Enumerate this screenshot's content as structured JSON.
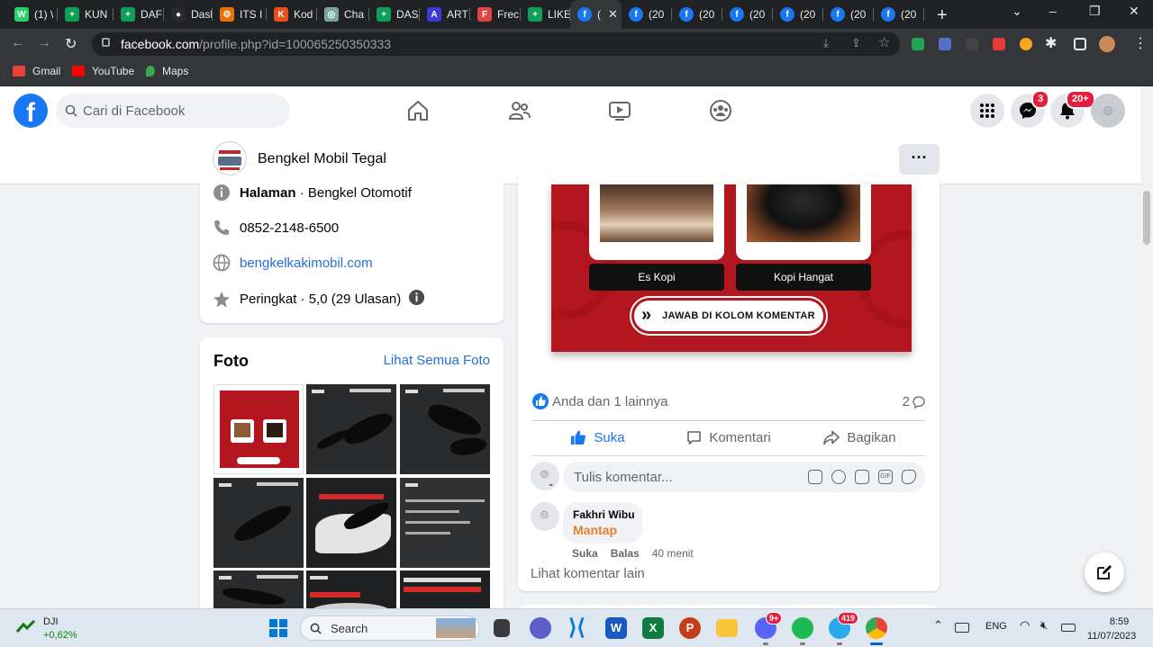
{
  "browser": {
    "tabs": [
      {
        "label": "(1) \\",
        "color": "#25d366",
        "glyph": "W"
      },
      {
        "label": "KUN",
        "color": "#0f9d58",
        "glyph": "+"
      },
      {
        "label": "DAF",
        "color": "#0f9d58",
        "glyph": "+"
      },
      {
        "label": "Dasl",
        "color": "#2a2a2a",
        "glyph": "●"
      },
      {
        "label": "ITS I",
        "color": "#e8710a",
        "glyph": "⚙"
      },
      {
        "label": "Kod",
        "color": "#e8501a",
        "glyph": "K"
      },
      {
        "label": "Cha",
        "color": "#74aa9c",
        "glyph": "◎"
      },
      {
        "label": "DAS",
        "color": "#0f9d58",
        "glyph": "+"
      },
      {
        "label": "ART",
        "color": "#3b3bd6",
        "glyph": "A"
      },
      {
        "label": "Frec",
        "color": "#e04646",
        "glyph": "F"
      },
      {
        "label": "LIKE",
        "color": "#0f9d58",
        "glyph": "+"
      },
      {
        "label": "(",
        "color": "#1877f2",
        "glyph": "f"
      },
      {
        "label": "(20",
        "color": "#1877f2",
        "glyph": "f"
      },
      {
        "label": "(20",
        "color": "#1877f2",
        "glyph": "f"
      },
      {
        "label": "(20",
        "color": "#1877f2",
        "glyph": "f"
      },
      {
        "label": "(20",
        "color": "#1877f2",
        "glyph": "f"
      },
      {
        "label": "(20",
        "color": "#1877f2",
        "glyph": "f"
      },
      {
        "label": "(20",
        "color": "#1877f2",
        "glyph": "f"
      }
    ],
    "url_host": "facebook.com",
    "url_path": "/profile.php?id=100065250350333",
    "bookmarks": [
      {
        "label": "Gmail",
        "color": "#ea4335"
      },
      {
        "label": "YouTube",
        "color": "#ff0000"
      },
      {
        "label": "Maps",
        "color": "#34a853"
      }
    ]
  },
  "facebook": {
    "search_placeholder": "Cari di Facebook",
    "messenger_badge": "3",
    "notif_badge": "20+",
    "page_name": "Bengkel Mobil Tegal",
    "more_label": "···"
  },
  "intro": {
    "category_bold": "Halaman",
    "category_rest": " · Bengkel Otomotif",
    "phone": "0852-2148-6500",
    "website": "bengkelkakimobil.com",
    "rating": "Peringkat · 5,0 (29 Ulasan)"
  },
  "photos": {
    "title": "Foto",
    "see_all": "Lihat Semua Foto"
  },
  "post": {
    "option_a": "Es Kopi",
    "option_b": "Kopi Hangat",
    "cta": "JAWAB DI KOLOM KOMENTAR",
    "reactions": "Anda dan 1 lainnya",
    "comment_count": "2",
    "like_label": "Suka",
    "comment_label": "Komentari",
    "share_label": "Bagikan",
    "comment_placeholder": "Tulis komentar...",
    "comment": {
      "author": "Fakhri Wibu",
      "text": "Mantap",
      "like": "Suka",
      "reply": "Balas",
      "time": "40 menit"
    },
    "more_comments": "Lihat komentar lain"
  },
  "taskbar": {
    "stock_name": "DJI",
    "stock_change": "+0,62%",
    "search_label": "Search",
    "discord_badge": "9+",
    "telegram_badge": "419",
    "lang": "ENG",
    "time": "8:59",
    "date": "11/07/2023"
  }
}
